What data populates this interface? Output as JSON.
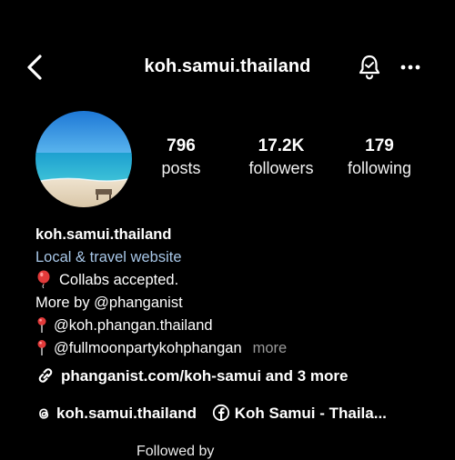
{
  "header": {
    "back_icon": "chevron-left-icon",
    "title": "koh.samui.thailand",
    "bell_icon": "bell-icon",
    "more_icon": "more-horizontal-icon"
  },
  "stats": [
    {
      "value": "796",
      "label": "posts"
    },
    {
      "value": "17.2K",
      "label": "followers"
    },
    {
      "value": "179",
      "label": "following"
    }
  ],
  "bio": {
    "name": "koh.samui.thailand",
    "category": "Local & travel website",
    "line1": "Collabs accepted.",
    "line2": "More by @phanganist",
    "line3": "@koh.phangan.thailand",
    "line4": "@fullmoonpartykohphangan",
    "more_label": "more"
  },
  "link": {
    "text": "phanganist.com/koh-samui and 3 more"
  },
  "social": {
    "threads": "koh.samui.thailand",
    "facebook": "Koh Samui - Thaila..."
  },
  "footer": {
    "followed_by": "Followed by"
  },
  "colors": {
    "background": "#000000",
    "category": "#a8c7e8",
    "muted": "#9a9a9a"
  }
}
